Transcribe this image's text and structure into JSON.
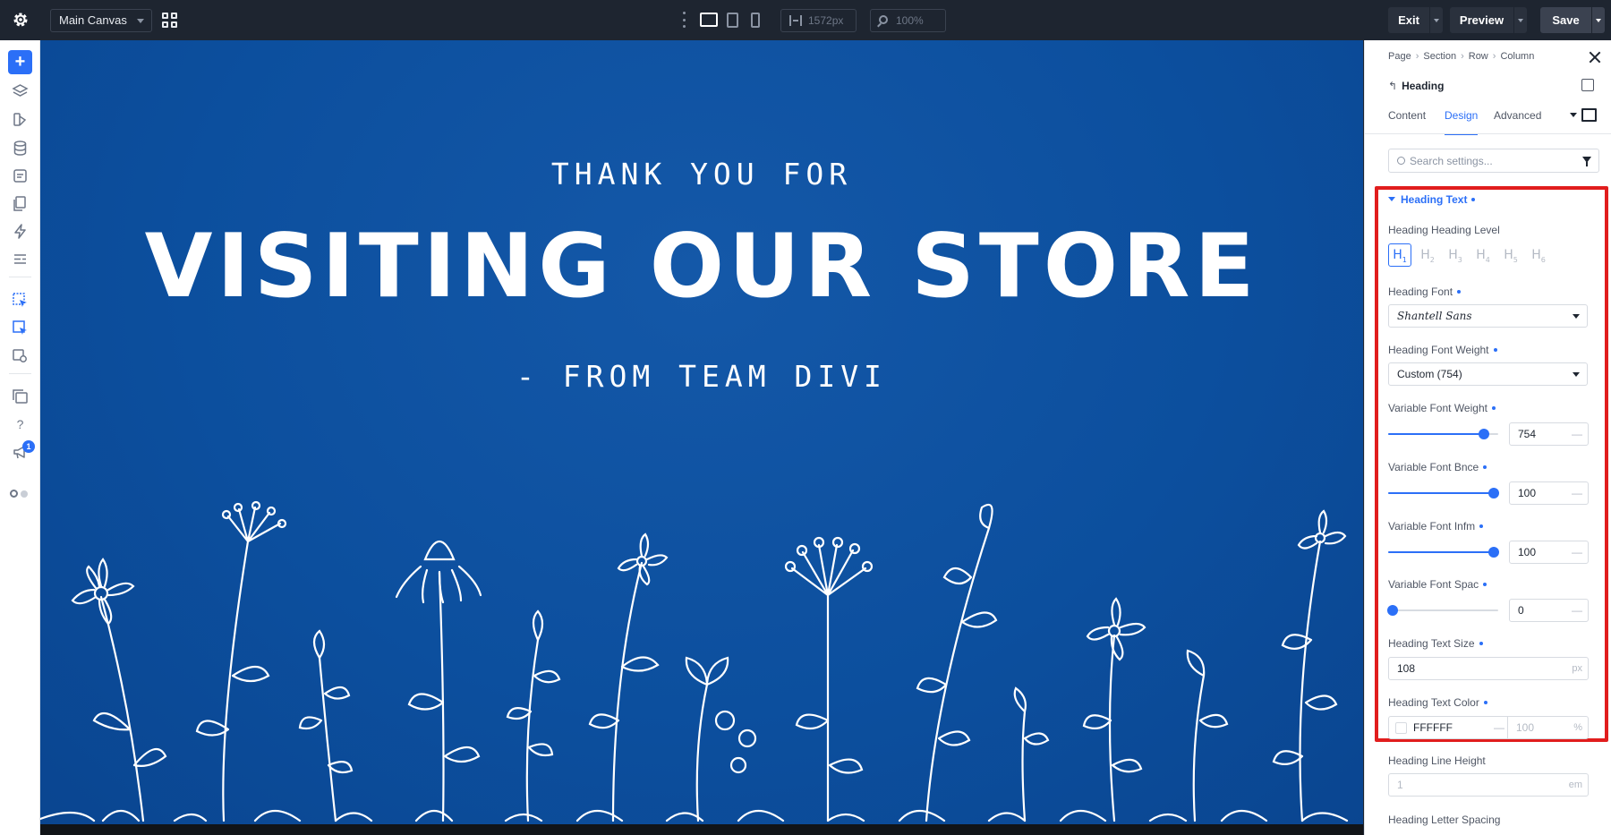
{
  "topbar": {
    "canvas_select": "Main Canvas",
    "width_value": "1572px",
    "zoom_value": "100%",
    "exit_label": "Exit",
    "preview_label": "Preview",
    "save_label": "Save"
  },
  "sidebar": {
    "notification_count": "1",
    "help_label": "?"
  },
  "canvas": {
    "kicker": "THANK YOU FOR",
    "headline": "VISITING OUR STORE",
    "subline": "- FROM TEAM DIVI",
    "background_color": "#0c4f9e"
  },
  "panel": {
    "breadcrumb": [
      "Page",
      "Section",
      "Row",
      "Column"
    ],
    "element_title": "Heading",
    "tabs": [
      "Content",
      "Design",
      "Advanced"
    ],
    "active_tab": "Design",
    "search_placeholder": "Search settings...",
    "group_title": "Heading Text",
    "heading_level": {
      "label": "Heading Heading Level",
      "levels": [
        "H1",
        "H2",
        "H3",
        "H4",
        "H5",
        "H6"
      ],
      "selected": "H1"
    },
    "heading_font": {
      "label": "Heading Font",
      "value": "Shantell Sans"
    },
    "heading_font_weight": {
      "label": "Heading Font Weight",
      "value": "Custom (754)"
    },
    "variable_font_weight": {
      "label": "Variable Font Weight",
      "value": "754",
      "level_fraction": 0.87
    },
    "variable_font_bnce": {
      "label": "Variable Font Bnce",
      "value": "100",
      "level_fraction": 0.96
    },
    "variable_font_infm": {
      "label": "Variable Font Infm",
      "value": "100",
      "level_fraction": 0.96
    },
    "variable_font_spac": {
      "label": "Variable Font Spac",
      "value": "0",
      "level_fraction": 0.04
    },
    "heading_text_size": {
      "label": "Heading Text Size",
      "value": "108",
      "unit": "px"
    },
    "heading_text_color": {
      "label": "Heading Text Color",
      "hex": "FFFFFF",
      "opacity": "100",
      "opacity_unit": "%"
    },
    "heading_line_height": {
      "label": "Heading Line Height",
      "value": "1",
      "unit": "em"
    },
    "heading_letter_spacing": {
      "label": "Heading Letter Spacing"
    },
    "dash": "—"
  },
  "colors": {
    "accent": "#2b6ff7",
    "highlight": "#e11d1d",
    "topbar": "#1e2530"
  }
}
